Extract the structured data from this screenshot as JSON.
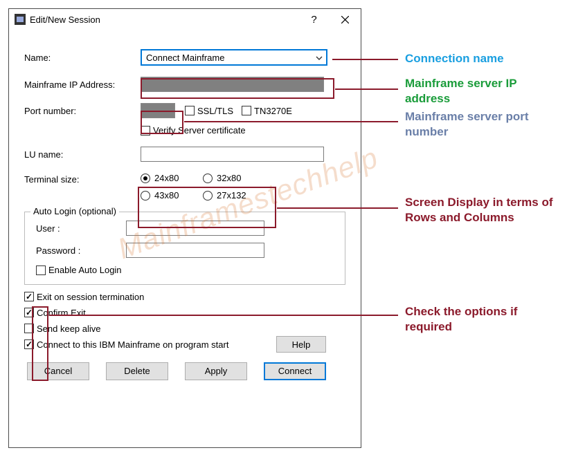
{
  "dialog": {
    "title": "Edit/New Session"
  },
  "fields": {
    "name_label": "Name:",
    "name_value": "Connect Mainframe",
    "ip_label": "Mainframe IP Address:",
    "port_label": "Port number:",
    "ssl_label": "SSL/TLS",
    "tn3270e_label": "TN3270E",
    "verify_cert_label": "Verify Server certificate",
    "lu_label": "LU name:",
    "terminal_label": "Terminal size:"
  },
  "terminal_sizes": {
    "opt1": "24x80",
    "opt2": "32x80",
    "opt3": "43x80",
    "opt4": "27x132"
  },
  "autologin": {
    "group_title": "Auto Login (optional)",
    "user_label": "User :",
    "password_label": "Password :",
    "enable_label": "Enable Auto Login"
  },
  "options": {
    "exit_on_term": "Exit on session termination",
    "confirm_exit": "Confirm Exit",
    "keep_alive": "Send keep alive",
    "connect_on_start": "Connect to this IBM Mainframe on program start"
  },
  "buttons": {
    "help": "Help",
    "cancel": "Cancel",
    "delete": "Delete",
    "apply": "Apply",
    "connect": "Connect"
  },
  "annotations": {
    "conn_name": "Connection name",
    "ip": "Mainframe server IP address",
    "port": "Mainframe server port number",
    "screen": "Screen Display in terms of Rows and Columns",
    "check_opts": "Check the options if required"
  },
  "watermark": "Mainframestechhelp",
  "colors": {
    "anno_conn": "#1a9fe0",
    "anno_ip": "#1a9c3a",
    "anno_port": "#6a7fa8",
    "anno_screen": "#8b1a2b",
    "anno_check": "#8b1a2b",
    "highlight_border": "#8b1a2b"
  }
}
